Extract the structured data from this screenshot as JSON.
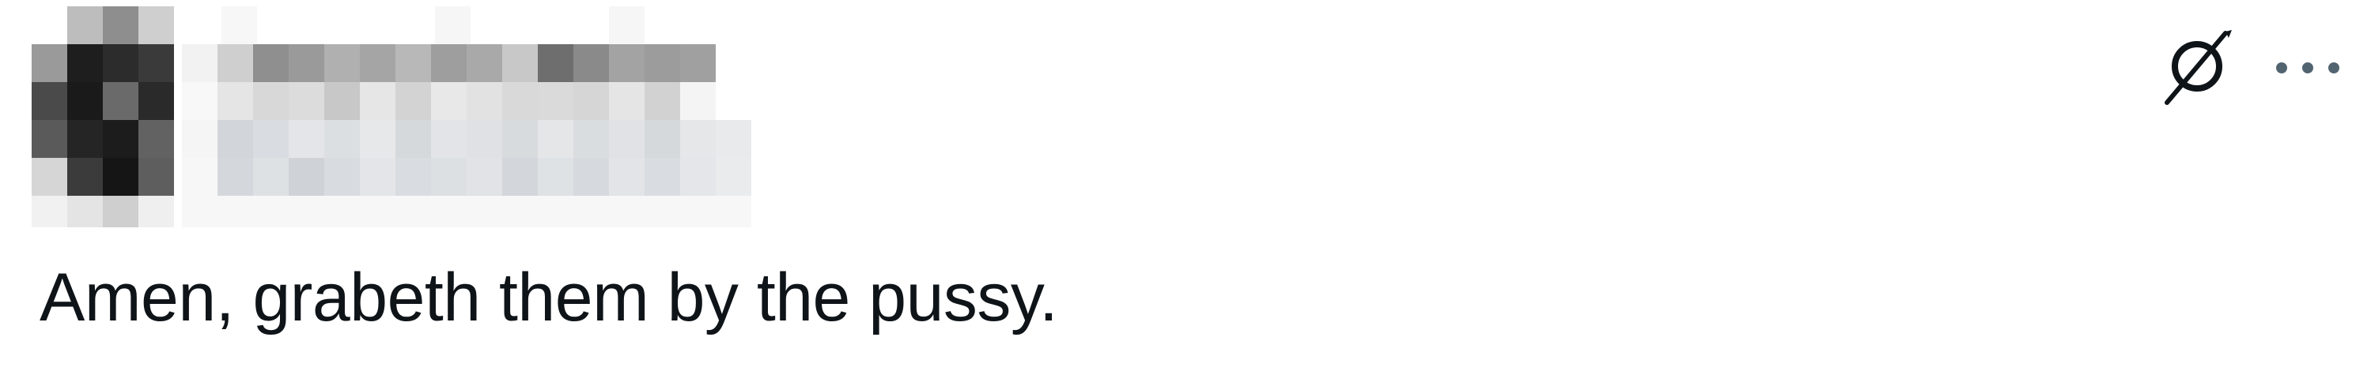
{
  "post": {
    "text": "Amen, grabeth them by the pussy."
  },
  "header": {
    "author_censored": true
  },
  "actions": {
    "grok_icon": "grok-icon",
    "more_icon": "more-options-icon"
  },
  "colors": {
    "text": "#0f1419",
    "icon": "#536471",
    "background": "#ffffff"
  }
}
